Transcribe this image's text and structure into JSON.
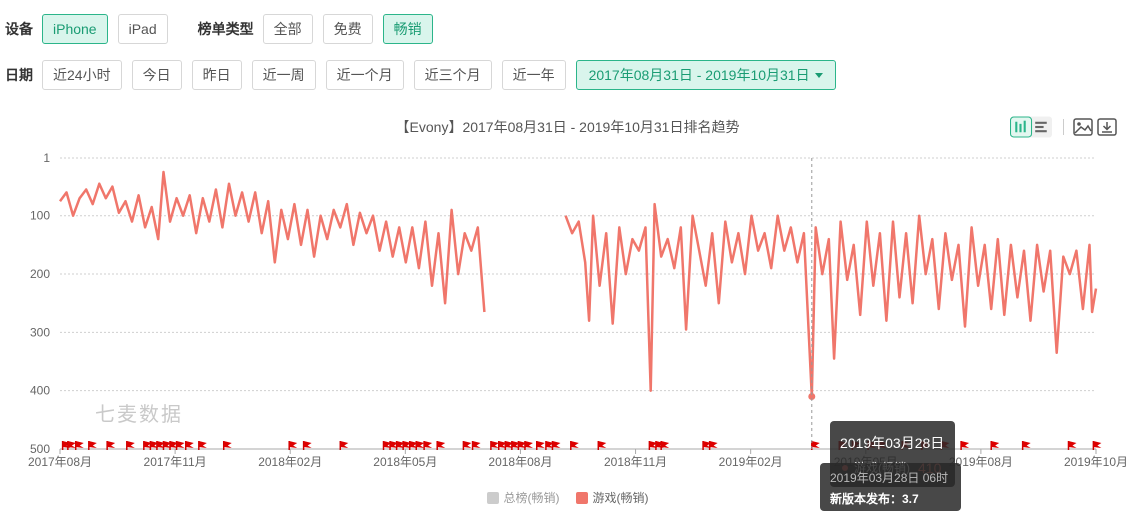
{
  "filters": {
    "device_label": "设备",
    "devices": [
      "iPhone",
      "iPad"
    ],
    "device_active": 0,
    "list_type_label": "榜单类型",
    "list_types": [
      "全部",
      "免费",
      "畅销"
    ],
    "list_type_active": 2,
    "date_label": "日期",
    "date_options": [
      "近24小时",
      "今日",
      "昨日",
      "近一周",
      "近一个月",
      "近三个月",
      "近一年"
    ],
    "date_range": "2017年08月31日 - 2019年10月31日"
  },
  "toolbox": {
    "icons": [
      "bar-line-toggle-icon",
      "image-save-icon",
      "download-icon"
    ]
  },
  "watermark": "七麦数据",
  "tooltip": {
    "date": "2019年03月28日",
    "series_label": "游戏(畅销)",
    "value": "410",
    "time": "2019年03月28日 06时",
    "release": "新版本发布：3.7"
  },
  "chart_data": {
    "type": "line",
    "title": "【Evony】2017年08月31日 - 2019年10月31日排名趋势",
    "x_ticks": [
      "2017年08月",
      "2017年11月",
      "2018年02月",
      "2018年05月",
      "2018年08月",
      "2018年11月",
      "2019年02月",
      "2019年05月",
      "2019年08月",
      "2019年10月"
    ],
    "x_range": [
      "2017-08-31",
      "2019-10-31"
    ],
    "y_ticks": [
      1,
      100,
      200,
      300,
      400,
      500
    ],
    "ylim": [
      1,
      500
    ],
    "y_inverted": true,
    "grid": true,
    "legend": {
      "position": "bottom-center",
      "entries": [
        {
          "name": "总榜(畅销)",
          "color": "#cccccc",
          "enabled": false
        },
        {
          "name": "游戏(畅销)",
          "color": "#f0766b",
          "enabled": true
        }
      ]
    },
    "crosshair_date": "2019-03-28",
    "series": [
      {
        "name": "游戏(畅销)",
        "color": "#f0766b",
        "points": [
          [
            "2017-08-31",
            75
          ],
          [
            "2017-09-05",
            60
          ],
          [
            "2017-09-10",
            100
          ],
          [
            "2017-09-15",
            70
          ],
          [
            "2017-09-20",
            55
          ],
          [
            "2017-09-25",
            80
          ],
          [
            "2017-09-30",
            45
          ],
          [
            "2017-10-05",
            70
          ],
          [
            "2017-10-10",
            50
          ],
          [
            "2017-10-15",
            95
          ],
          [
            "2017-10-20",
            75
          ],
          [
            "2017-10-25",
            110
          ],
          [
            "2017-10-30",
            65
          ],
          [
            "2017-11-04",
            120
          ],
          [
            "2017-11-09",
            85
          ],
          [
            "2017-11-14",
            140
          ],
          [
            "2017-11-18",
            25
          ],
          [
            "2017-11-23",
            110
          ],
          [
            "2017-11-28",
            70
          ],
          [
            "2017-12-03",
            100
          ],
          [
            "2017-12-08",
            65
          ],
          [
            "2017-12-13",
            130
          ],
          [
            "2017-12-18",
            70
          ],
          [
            "2017-12-23",
            110
          ],
          [
            "2017-12-28",
            55
          ],
          [
            "2018-01-02",
            120
          ],
          [
            "2018-01-07",
            45
          ],
          [
            "2018-01-12",
            100
          ],
          [
            "2018-01-17",
            60
          ],
          [
            "2018-01-22",
            110
          ],
          [
            "2018-01-27",
            60
          ],
          [
            "2018-02-01",
            130
          ],
          [
            "2018-02-06",
            75
          ],
          [
            "2018-02-11",
            180
          ],
          [
            "2018-02-16",
            90
          ],
          [
            "2018-02-21",
            140
          ],
          [
            "2018-02-26",
            80
          ],
          [
            "2018-03-03",
            150
          ],
          [
            "2018-03-08",
            90
          ],
          [
            "2018-03-13",
            170
          ],
          [
            "2018-03-18",
            100
          ],
          [
            "2018-03-23",
            140
          ],
          [
            "2018-03-28",
            90
          ],
          [
            "2018-04-02",
            120
          ],
          [
            "2018-04-07",
            80
          ],
          [
            "2018-04-12",
            150
          ],
          [
            "2018-04-17",
            95
          ],
          [
            "2018-04-22",
            130
          ],
          [
            "2018-04-27",
            100
          ],
          [
            "2018-05-02",
            160
          ],
          [
            "2018-05-07",
            110
          ],
          [
            "2018-05-12",
            170
          ],
          [
            "2018-05-17",
            120
          ],
          [
            "2018-05-22",
            180
          ],
          [
            "2018-05-27",
            120
          ],
          [
            "2018-06-01",
            190
          ],
          [
            "2018-06-06",
            110
          ],
          [
            "2018-06-11",
            220
          ],
          [
            "2018-06-16",
            130
          ],
          [
            "2018-06-21",
            250
          ],
          [
            "2018-06-26",
            90
          ],
          [
            "2018-07-01",
            200
          ],
          [
            "2018-07-06",
            130
          ],
          [
            "2018-07-11",
            160
          ],
          [
            "2018-07-16",
            120
          ],
          [
            "2018-07-21",
            265
          ],
          [
            "2018-09-21",
            100
          ],
          [
            "2018-09-26",
            130
          ],
          [
            "2018-10-01",
            110
          ],
          [
            "2018-10-06",
            180
          ],
          [
            "2018-10-09",
            280
          ],
          [
            "2018-10-12",
            100
          ],
          [
            "2018-10-17",
            220
          ],
          [
            "2018-10-22",
            130
          ],
          [
            "2018-10-27",
            285
          ],
          [
            "2018-11-01",
            120
          ],
          [
            "2018-11-06",
            200
          ],
          [
            "2018-11-11",
            140
          ],
          [
            "2018-11-16",
            160
          ],
          [
            "2018-11-21",
            120
          ],
          [
            "2018-11-25",
            400
          ],
          [
            "2018-11-28",
            80
          ],
          [
            "2018-12-03",
            170
          ],
          [
            "2018-12-08",
            140
          ],
          [
            "2018-12-13",
            190
          ],
          [
            "2018-12-18",
            120
          ],
          [
            "2018-12-22",
            295
          ],
          [
            "2018-12-27",
            100
          ],
          [
            "2019-01-01",
            160
          ],
          [
            "2019-01-06",
            220
          ],
          [
            "2019-01-11",
            130
          ],
          [
            "2019-01-16",
            250
          ],
          [
            "2019-01-21",
            110
          ],
          [
            "2019-01-26",
            180
          ],
          [
            "2019-01-31",
            130
          ],
          [
            "2019-02-05",
            200
          ],
          [
            "2019-02-10",
            100
          ],
          [
            "2019-02-15",
            160
          ],
          [
            "2019-02-20",
            130
          ],
          [
            "2019-02-25",
            190
          ],
          [
            "2019-03-02",
            100
          ],
          [
            "2019-03-07",
            160
          ],
          [
            "2019-03-12",
            120
          ],
          [
            "2019-03-17",
            180
          ],
          [
            "2019-03-22",
            130
          ],
          [
            "2019-03-28",
            410
          ],
          [
            "2019-03-31",
            120
          ],
          [
            "2019-04-05",
            200
          ],
          [
            "2019-04-10",
            140
          ],
          [
            "2019-04-14",
            345
          ],
          [
            "2019-04-19",
            110
          ],
          [
            "2019-04-24",
            210
          ],
          [
            "2019-04-29",
            150
          ],
          [
            "2019-05-04",
            270
          ],
          [
            "2019-05-09",
            110
          ],
          [
            "2019-05-14",
            220
          ],
          [
            "2019-05-19",
            130
          ],
          [
            "2019-05-24",
            280
          ],
          [
            "2019-05-29",
            110
          ],
          [
            "2019-06-03",
            240
          ],
          [
            "2019-06-08",
            130
          ],
          [
            "2019-06-13",
            250
          ],
          [
            "2019-06-18",
            100
          ],
          [
            "2019-06-23",
            200
          ],
          [
            "2019-06-28",
            140
          ],
          [
            "2019-07-03",
            260
          ],
          [
            "2019-07-08",
            130
          ],
          [
            "2019-07-13",
            210
          ],
          [
            "2019-07-18",
            150
          ],
          [
            "2019-07-23",
            290
          ],
          [
            "2019-07-28",
            120
          ],
          [
            "2019-08-02",
            220
          ],
          [
            "2019-08-07",
            150
          ],
          [
            "2019-08-12",
            260
          ],
          [
            "2019-08-17",
            140
          ],
          [
            "2019-08-22",
            270
          ],
          [
            "2019-08-27",
            150
          ],
          [
            "2019-09-01",
            240
          ],
          [
            "2019-09-06",
            160
          ],
          [
            "2019-09-11",
            280
          ],
          [
            "2019-09-16",
            150
          ],
          [
            "2019-09-21",
            230
          ],
          [
            "2019-09-26",
            160
          ],
          [
            "2019-10-01",
            335
          ],
          [
            "2019-10-06",
            170
          ],
          [
            "2019-10-11",
            200
          ],
          [
            "2019-10-16",
            160
          ],
          [
            "2019-10-21",
            260
          ],
          [
            "2019-10-26",
            150
          ],
          [
            "2019-10-28",
            265
          ],
          [
            "2019-10-31",
            225
          ]
        ]
      }
    ],
    "release_markers": [
      "2017-09-02",
      "2017-09-06",
      "2017-09-12",
      "2017-09-22",
      "2017-10-06",
      "2017-10-21",
      "2017-11-03",
      "2017-11-08",
      "2017-11-13",
      "2017-11-18",
      "2017-11-23",
      "2017-11-28",
      "2017-12-05",
      "2017-12-15",
      "2018-01-03",
      "2018-02-22",
      "2018-03-05",
      "2018-04-02",
      "2018-05-05",
      "2018-05-10",
      "2018-05-15",
      "2018-05-20",
      "2018-05-25",
      "2018-05-30",
      "2018-06-05",
      "2018-06-15",
      "2018-07-05",
      "2018-07-12",
      "2018-07-26",
      "2018-08-01",
      "2018-08-06",
      "2018-08-11",
      "2018-08-16",
      "2018-08-21",
      "2018-08-30",
      "2018-09-06",
      "2018-09-11",
      "2018-09-25",
      "2018-10-16",
      "2018-11-24",
      "2018-11-29",
      "2018-12-03",
      "2019-01-04",
      "2019-01-09",
      "2019-03-28",
      "2019-04-18",
      "2019-04-28",
      "2019-05-10",
      "2019-05-18",
      "2019-06-05",
      "2019-06-20",
      "2019-07-05",
      "2019-07-20",
      "2019-08-12",
      "2019-09-05",
      "2019-10-10",
      "2019-10-29"
    ]
  }
}
